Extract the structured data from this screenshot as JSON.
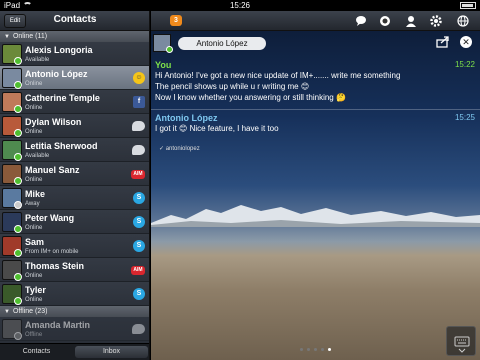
{
  "statusbar": {
    "device": "iPad",
    "time": "15:26"
  },
  "sidebar": {
    "edit_label": "Edit",
    "title": "Contacts",
    "online_group": "Online (11)",
    "offline_group": "Offline (23)",
    "contacts": [
      {
        "name": "Alexis Longoria",
        "status": "Available",
        "service": "none",
        "avatar": "#6b8a3a"
      },
      {
        "name": "Antonio López",
        "status": "Online",
        "service": "smile",
        "avatar": "#7a8aa0"
      },
      {
        "name": "Catherine Temple",
        "status": "Online",
        "service": "facebook",
        "avatar": "#c07a5a"
      },
      {
        "name": "Dylan Wilson",
        "status": "Online",
        "service": "bubble",
        "avatar": "#b85a3a"
      },
      {
        "name": "Letitia Sherwood",
        "status": "Available",
        "service": "bubble",
        "avatar": "#4f8a4f"
      },
      {
        "name": "Manuel Sanz",
        "status": "Online",
        "service": "aim",
        "avatar": "#8a5a3a"
      },
      {
        "name": "Mike",
        "status": "Away",
        "service": "skype",
        "avatar": "#5a7aa0"
      },
      {
        "name": "Peter Wang",
        "status": "Online",
        "service": "skype",
        "avatar": "#2b3a5a"
      },
      {
        "name": "Sam",
        "status": "From IM+ on mobile",
        "service": "skype",
        "avatar": "#a03a2a"
      },
      {
        "name": "Thomas Stein",
        "status": "Online",
        "service": "aim",
        "avatar": "#4a4a4a"
      },
      {
        "name": "Tyler",
        "status": "Online",
        "service": "skype",
        "avatar": "#3a5a2a"
      }
    ],
    "offline_contacts": [
      {
        "name": "Amanda Martin",
        "status": "Offline",
        "service": "bubble",
        "avatar": "#666"
      }
    ],
    "tabs": [
      "Contacts",
      "Inbox"
    ]
  },
  "main": {
    "badge_count": "3",
    "chat_with": "Antonio López",
    "messages": [
      {
        "sender": "You",
        "time": "15:22",
        "color": "#7ee04a",
        "lines": [
          "Hi Antonio! I've got a new nice update of IM+....... write me something",
          "The pencil shows up while u r writing me 😊",
          "Now I know whether you answering or still thinking 🤔"
        ]
      },
      {
        "sender": "Antonio López",
        "time": "15:25",
        "color": "#7fc8f0",
        "lines": [
          "I got it 😊 Nice feature, I have it too"
        ]
      }
    ],
    "read_by": "✓ antoniolopez"
  },
  "icons": {
    "chat": "chat-bubbles-icon",
    "status": "status-ring-icon",
    "profile": "person-icon",
    "settings": "gear-icon",
    "web": "globe-icon"
  }
}
